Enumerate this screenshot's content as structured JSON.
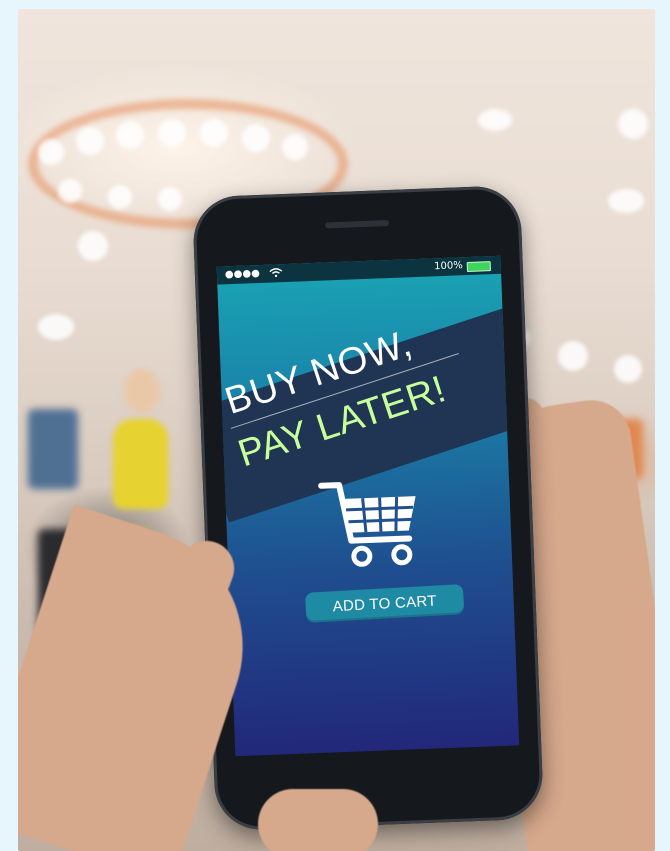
{
  "screen": {
    "status": {
      "signal": "●●●●",
      "battery": "100%"
    },
    "headline_1": "BUY NOW,",
    "headline_2": "PAY LATER!",
    "button_label": "ADD TO CART",
    "colors": {
      "screen_top": "#1aa5b5",
      "screen_bottom": "#22277a",
      "banner": "#1f3553",
      "headline_2": "#c8ff9a",
      "button": "#1f8aa3",
      "battery": "#3fd45c"
    },
    "icons": [
      "signal-icon",
      "wifi-icon",
      "battery-icon",
      "shopping-cart-icon"
    ]
  }
}
